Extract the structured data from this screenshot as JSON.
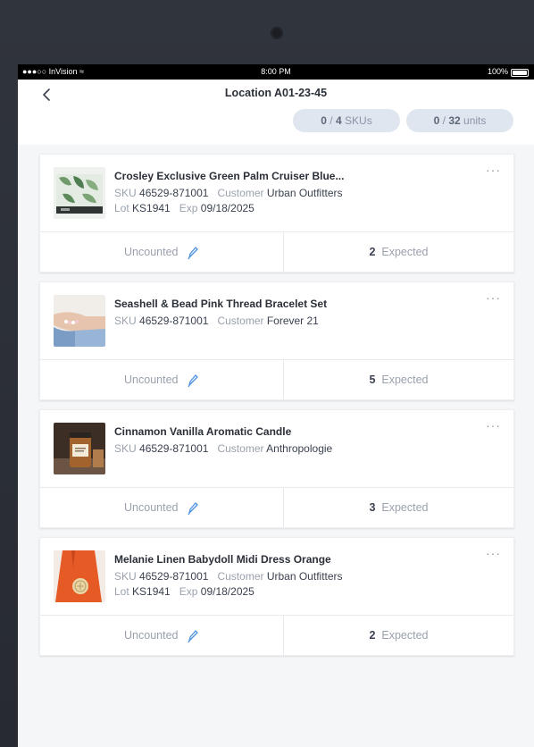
{
  "status_bar": {
    "carrier": "●●●○○ InVision",
    "time": "8:00 PM",
    "battery": "100%"
  },
  "header": {
    "title": "Location A01-23-45",
    "skus_pill": {
      "counted": "0",
      "total": "4",
      "label": "SKUs"
    },
    "units_pill": {
      "counted": "0",
      "total": "32",
      "label": "units"
    }
  },
  "labels": {
    "sku": "SKU",
    "customer": "Customer",
    "lot": "Lot",
    "exp": "Exp",
    "uncounted": "Uncounted",
    "expected": "Expected",
    "more": "···"
  },
  "items": [
    {
      "name": "Crosley Exclusive Green Palm Cruiser Blue...",
      "sku": "46529-871001",
      "customer": "Urban Outfitters",
      "lot": "KS1941",
      "exp": "09/18/2025",
      "expected": "2",
      "thumb": "turntable-photo"
    },
    {
      "name": "Seashell & Bead Pink Thread Bracelet Set",
      "sku": "46529-871001",
      "customer": "Forever 21",
      "expected": "5",
      "thumb": "bracelet-photo"
    },
    {
      "name": "Cinnamon Vanilla Aromatic Candle",
      "sku": "46529-871001",
      "customer": "Anthropologie",
      "expected": "3",
      "thumb": "candle-photo"
    },
    {
      "name": "Melanie Linen Babydoll Midi Dress Orange",
      "sku": "46529-871001",
      "customer": "Urban Outfitters",
      "lot": "KS1941",
      "exp": "09/18/2025",
      "expected": "2",
      "thumb": "dress-photo"
    }
  ],
  "colors": {
    "accent": "#4a90e2",
    "pill_bg": "#dfe6ef",
    "background": "#f5f6f8"
  }
}
